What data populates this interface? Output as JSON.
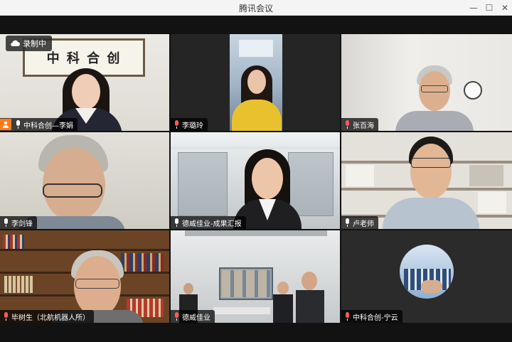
{
  "window": {
    "title": "腾讯会议"
  },
  "recording": {
    "label": "录制中"
  },
  "participants": [
    {
      "name": "中科合创—李娟",
      "host": true,
      "mic": "white"
    },
    {
      "name": "李璐玲",
      "host": false,
      "mic": "red"
    },
    {
      "name": "张百海",
      "host": false,
      "mic": "red",
      "speaking": true
    },
    {
      "name": "李剑锋",
      "host": false,
      "mic": "white"
    },
    {
      "name": "德威佳业-成果汇报",
      "host": false,
      "mic": "white"
    },
    {
      "name": "卢老师",
      "host": false,
      "mic": "white"
    },
    {
      "name": "毕树生（北航机器人所）",
      "host": false,
      "mic": "red"
    },
    {
      "name": "德威佳业",
      "host": false,
      "mic": "red"
    },
    {
      "name": "中科合创-宁云",
      "host": false,
      "mic": "red"
    }
  ],
  "scene": {
    "wall_sign": "中 科 合 创"
  },
  "colors": {
    "speaking_border": "#1fbf5a",
    "host_badge": "#ff7a1a"
  }
}
